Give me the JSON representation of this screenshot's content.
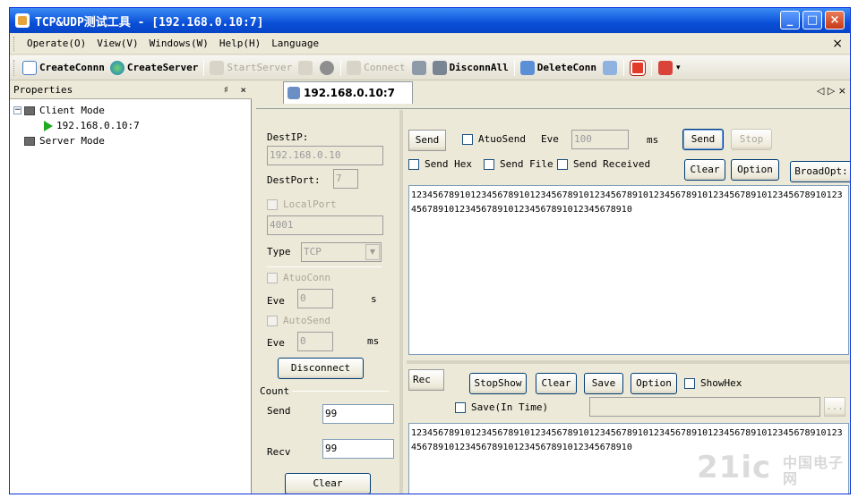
{
  "window": {
    "title": "TCP&UDP测试工具 - [192.168.0.10:7]",
    "controls": [
      "_",
      "□",
      "×"
    ]
  },
  "menu": {
    "items": [
      "Operate(O)",
      "View(V)",
      "Windows(W)",
      "Help(H)",
      "Language"
    ],
    "close": "×"
  },
  "toolbar": {
    "create_conn": "CreateConnn",
    "create_server": "CreateServer",
    "start_server": "StartServer",
    "connect": "Connect",
    "disconn_all": "DisconnAll",
    "delete_conn": "DeleteConn"
  },
  "properties": {
    "title": "Properties",
    "pin": "♯",
    "close": "×",
    "tree": {
      "client_mode": "Client Mode",
      "connection": "192.168.0.10:7",
      "server_mode": "Server Mode",
      "expand": "−"
    }
  },
  "tab": {
    "label": "192.168.0.10:7",
    "nav": "◁ ▷ ×"
  },
  "conn": {
    "dest_ip_label": "DestIP:",
    "dest_ip_value": "192.168.0.10",
    "dest_port_label": "DestPort:",
    "dest_port_value": "7",
    "local_port_label": "LocalPort",
    "local_port_value": "4001",
    "type_label": "Type",
    "type_value": "TCP",
    "atuo_conn_label": "AtuoConn",
    "eve_label_1": "Eve",
    "eve_value_1": "0",
    "eve_unit_1": "s",
    "auto_send_label": "AutoSend",
    "eve_label_2": "Eve",
    "eve_value_2": "0",
    "eve_unit_2": "ms",
    "disconnect_button": "Disconnect"
  },
  "count": {
    "title": "Count",
    "send_label": "Send",
    "send_value": "99",
    "recv_label": "Recv",
    "recv_value": "99",
    "clear_button": "Clear"
  },
  "send_panel": {
    "send_tag": "Send",
    "atuo_send_label": "AtuoSend",
    "eve_label": "Eve",
    "eve_value": "100",
    "eve_unit": "ms",
    "send_button": "Send",
    "stop_button": "Stop",
    "send_hex_label": "Send Hex",
    "send_file_label": "Send File",
    "send_received_label": "Send Received",
    "clear_button": "Clear",
    "option_button": "Option",
    "broad_opt_button": "BroadOpt:",
    "content": "1234567891012345678910123456789101234567891012345678910123456789101234567891012345678910123456789101234567891012345678910"
  },
  "recv_panel": {
    "rec_tag": "Rec",
    "stop_show_button": "StopShow",
    "clear_button": "Clear",
    "save_button": "Save",
    "option_button": "Option",
    "show_hex_label": "ShowHex",
    "save_in_time_label": "Save(In Time)",
    "browse_button": "...",
    "content": "1234567891012345678910123456789101234567891012345678910123456789101234567891012345678910123456789101234567891012345678910"
  },
  "watermark": {
    "logo": "21ic",
    "cn": "中国电子网"
  },
  "colors": {
    "titlebar": "#0a4fd8",
    "window_face": "#ece9d8",
    "play_icon": "#1faa1f"
  }
}
